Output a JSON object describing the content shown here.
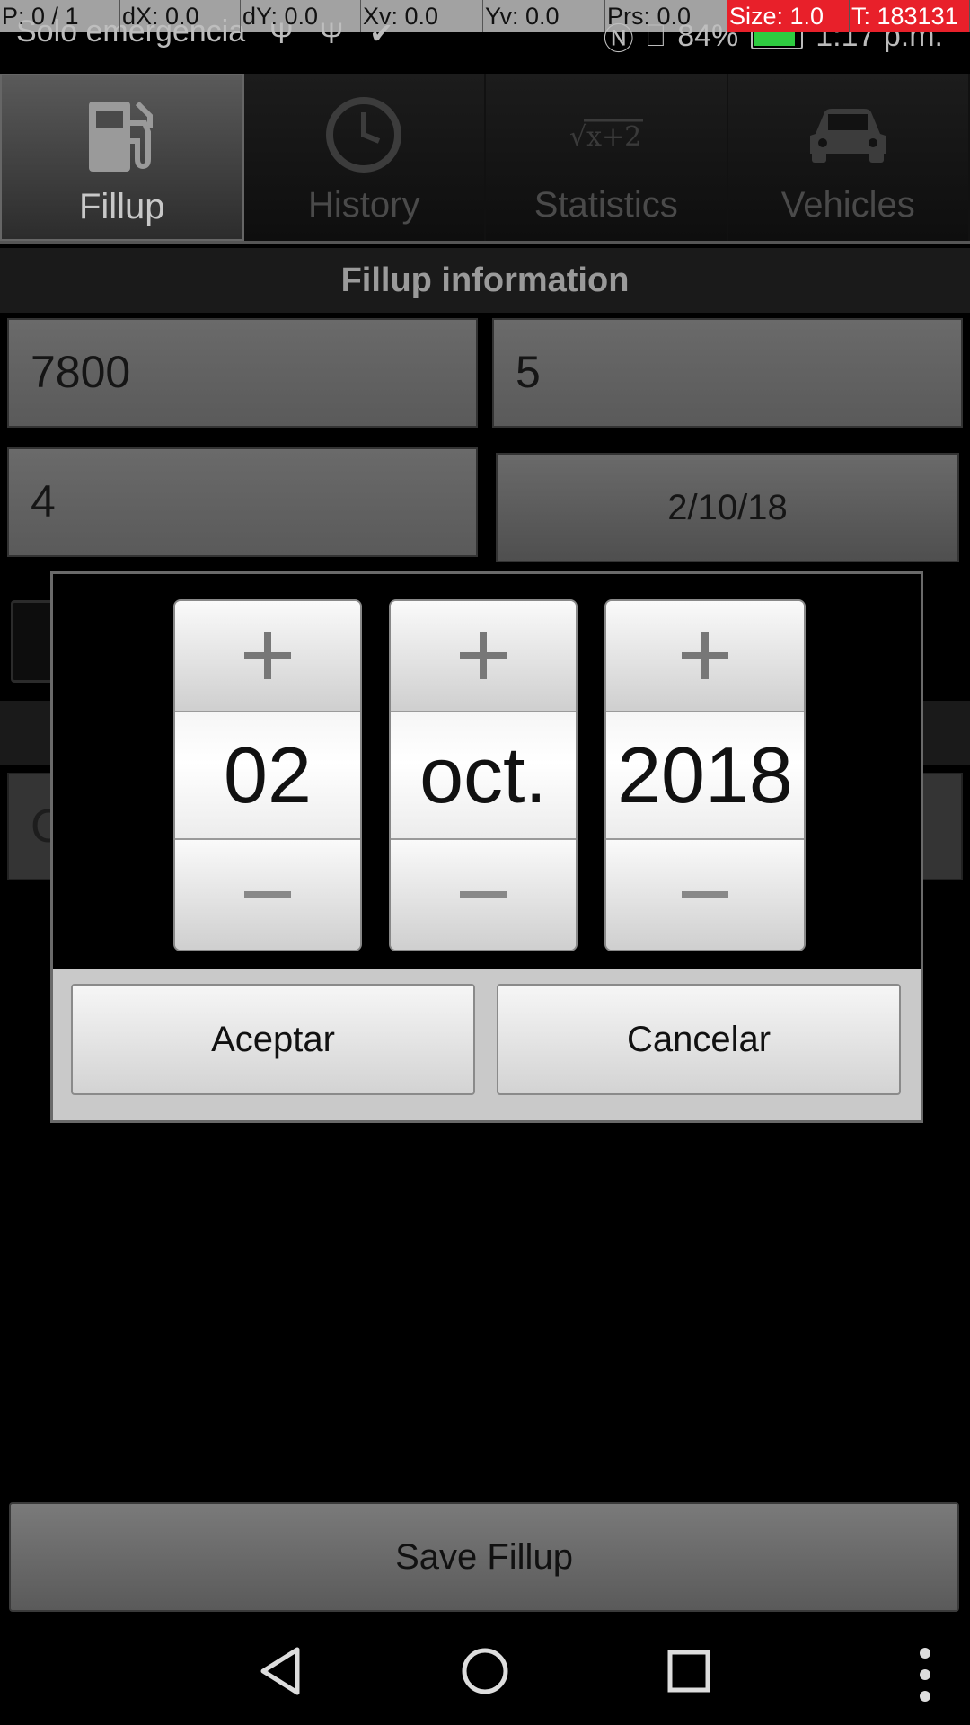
{
  "debug_overlay": [
    "P: 0 / 1",
    "dX: 0.0",
    "dY: 0.0",
    "Xv: 0.0",
    "Yv: 0.0",
    "Prs: 0.0",
    "Size: 1.0",
    "T: 183131"
  ],
  "status_bar": {
    "carrier": "Solo emergencia",
    "battery": "84%",
    "time": "1:17 p.m."
  },
  "tabs": [
    {
      "label": "Fillup",
      "icon": "fuel-pump-icon",
      "active": true
    },
    {
      "label": "History",
      "icon": "clock-icon",
      "active": false
    },
    {
      "label": "Statistics",
      "icon": "sqrt-formula-icon",
      "active": false
    },
    {
      "label": "Vehicles",
      "icon": "car-icon",
      "active": false
    }
  ],
  "section_header": "Fillup information",
  "fields": {
    "odometer": "7800",
    "volume": "5",
    "price": "4",
    "date": "2/10/18"
  },
  "date_picker": {
    "day": "02",
    "month": "oct.",
    "year": "2018",
    "accept_label": "Aceptar",
    "cancel_label": "Cancelar"
  },
  "save_button": "Save Fillup"
}
